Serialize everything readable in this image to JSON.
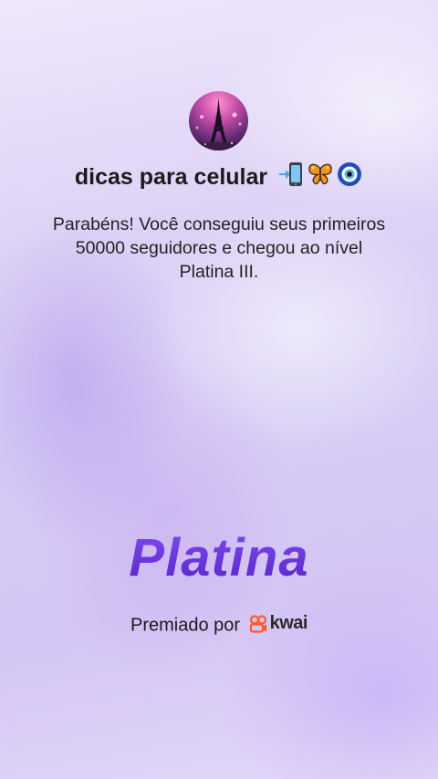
{
  "profile": {
    "name": "dicas para celular",
    "name_emojis": [
      "phone-arrow-emoji",
      "butterfly-emoji",
      "nazar-amulet-emoji"
    ],
    "avatar": "eiffel-tower-night-photo"
  },
  "message": "Parabéns! Você conseguiu seus primeiros 50000 seguidores e chegou ao nível Platina III.",
  "level": {
    "title": "Platina",
    "color": "#6a36d8"
  },
  "awarded": {
    "label": "Premiado por",
    "brand": "kwai",
    "brand_color": "#ff5a24"
  }
}
